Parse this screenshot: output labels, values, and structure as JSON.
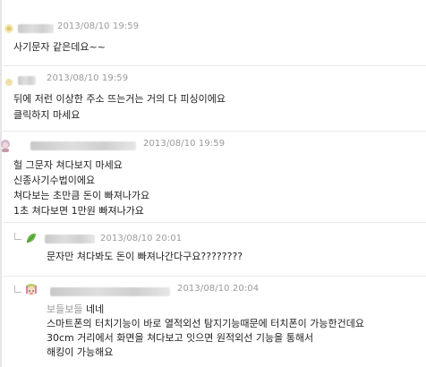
{
  "comments": [
    {
      "date": "2013/08/10 19:59",
      "lines": [
        "사기문자 같은데요~~"
      ]
    },
    {
      "date": "2013/08/10 19:59",
      "lines": [
        "뒤에 저런 이상한 주소 뜨는거는 거의 다 피싱이에요",
        "클릭하지 마세요"
      ]
    },
    {
      "date": "2013/08/10 19:59",
      "lines": [
        "헐 그문자 쳐다보지 마세요",
        "신종사기수법이에요",
        "쳐다보는 초만큼 돈이 빠져나가요",
        "1초 쳐다보면 1만원 빠져나가요"
      ]
    }
  ],
  "replies": [
    {
      "date": "2013/08/10 20:01",
      "lines": [
        "문자만 쳐다봐도 돈이 빠져나간다구요????????"
      ]
    },
    {
      "date": "2013/08/10 20:04",
      "nickname": "보들보들",
      "lines": [
        "네네",
        "스마트폰의 터치기능이 바로 열적외선 탐지기능때문에 터치폰이 가능한건데요",
        "30cm 거리에서 화면을 쳐다보고 잇으면 원적외선 기능을 통해서",
        "해킹이 가능해요"
      ]
    }
  ]
}
